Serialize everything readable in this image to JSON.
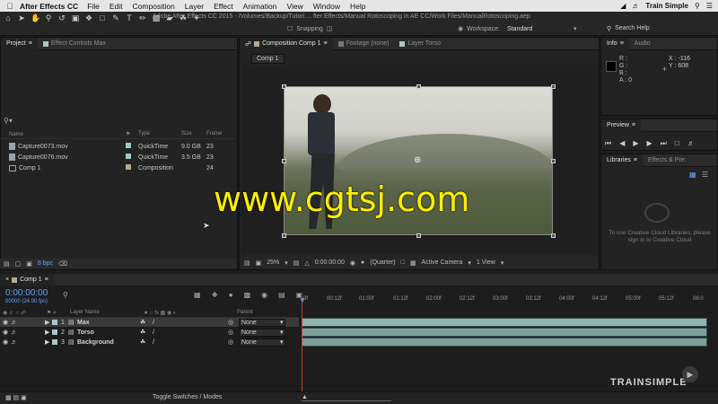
{
  "menubar": {
    "app_name": "After Effects CC",
    "items": [
      "File",
      "Edit",
      "Composition",
      "Layer",
      "Effect",
      "Animation",
      "View",
      "Window",
      "Help"
    ],
    "right_label": "Train Simple"
  },
  "toolbar": {
    "title": "Adobe After Effects CC 2015 - /Volumes/Backup/Tutori ... fter Effects/Manual Rotoscoping in AE CC/Work Files/ManualRotoscoping.aep",
    "snapping": "Snapping",
    "workspace_label": "Workspace:",
    "workspace_value": "Standard",
    "search_help": "Search Help"
  },
  "project": {
    "tabs": [
      "Project",
      "Effect Controls Max"
    ],
    "columns": {
      "name": "Name",
      "type": "Type",
      "size": "Size",
      "frame": "Frame"
    },
    "items": [
      {
        "name": "Capture0073.mov",
        "type": "QuickTime",
        "size": "9.0 GB",
        "frame": "23",
        "color": "#a5c8c6"
      },
      {
        "name": "Capture0076.mov",
        "type": "QuickTime",
        "size": "3.5 GB",
        "frame": "23",
        "color": "#a5c8c6"
      },
      {
        "name": "Comp 1",
        "type": "Composition",
        "size": "",
        "frame": "24",
        "color": "#b5a994"
      }
    ],
    "bpc": "8 bpc"
  },
  "composition": {
    "tabs": [
      "Composition Comp 1",
      "Footage (none)",
      "Layer Torso"
    ],
    "comp_badge": "Comp 1",
    "watermark": "www.cgtsj.com",
    "zoom": "25%",
    "timecode": "0:00:00:00",
    "quality": "(Quarter)",
    "camera": "Active Camera",
    "views": "1 View"
  },
  "info": {
    "tabs": [
      "Info",
      "Audio"
    ],
    "r": "R :",
    "g": "G :",
    "b": "B :",
    "a": "A : 0",
    "x": "X : -116",
    "y": "Y : 608"
  },
  "preview": {
    "title": "Preview"
  },
  "libraries": {
    "tabs": [
      "Libraries",
      "Effects & Pre:"
    ],
    "message": "To use Creative Cloud Libraries, please sign in to Creative Cloud"
  },
  "timeline": {
    "tab": "Comp 1",
    "timecode": "0:00:00:00",
    "timecode_sub": "00000 (24.00 fps)",
    "col_layer_name": "Layer Name",
    "col_parent": "Parent",
    "layers": [
      {
        "num": "1",
        "name": "Max",
        "parent": "None",
        "color": "#a5c8c6"
      },
      {
        "num": "2",
        "name": "Torso",
        "parent": "None",
        "color": "#a5c8c6"
      },
      {
        "num": "3",
        "name": "Background",
        "parent": "None",
        "color": "#a5c8c6"
      }
    ],
    "ruler": [
      "0f",
      "00:12f",
      "01:00f",
      "01:12f",
      "02:00f",
      "02:12f",
      "03:00f",
      "03:12f",
      "04:00f",
      "04:12f",
      "05:00f",
      "05:12f",
      "06:0"
    ],
    "toggle_label": "Toggle Switches / Modes",
    "brand": "TRAINSIMPLE"
  }
}
